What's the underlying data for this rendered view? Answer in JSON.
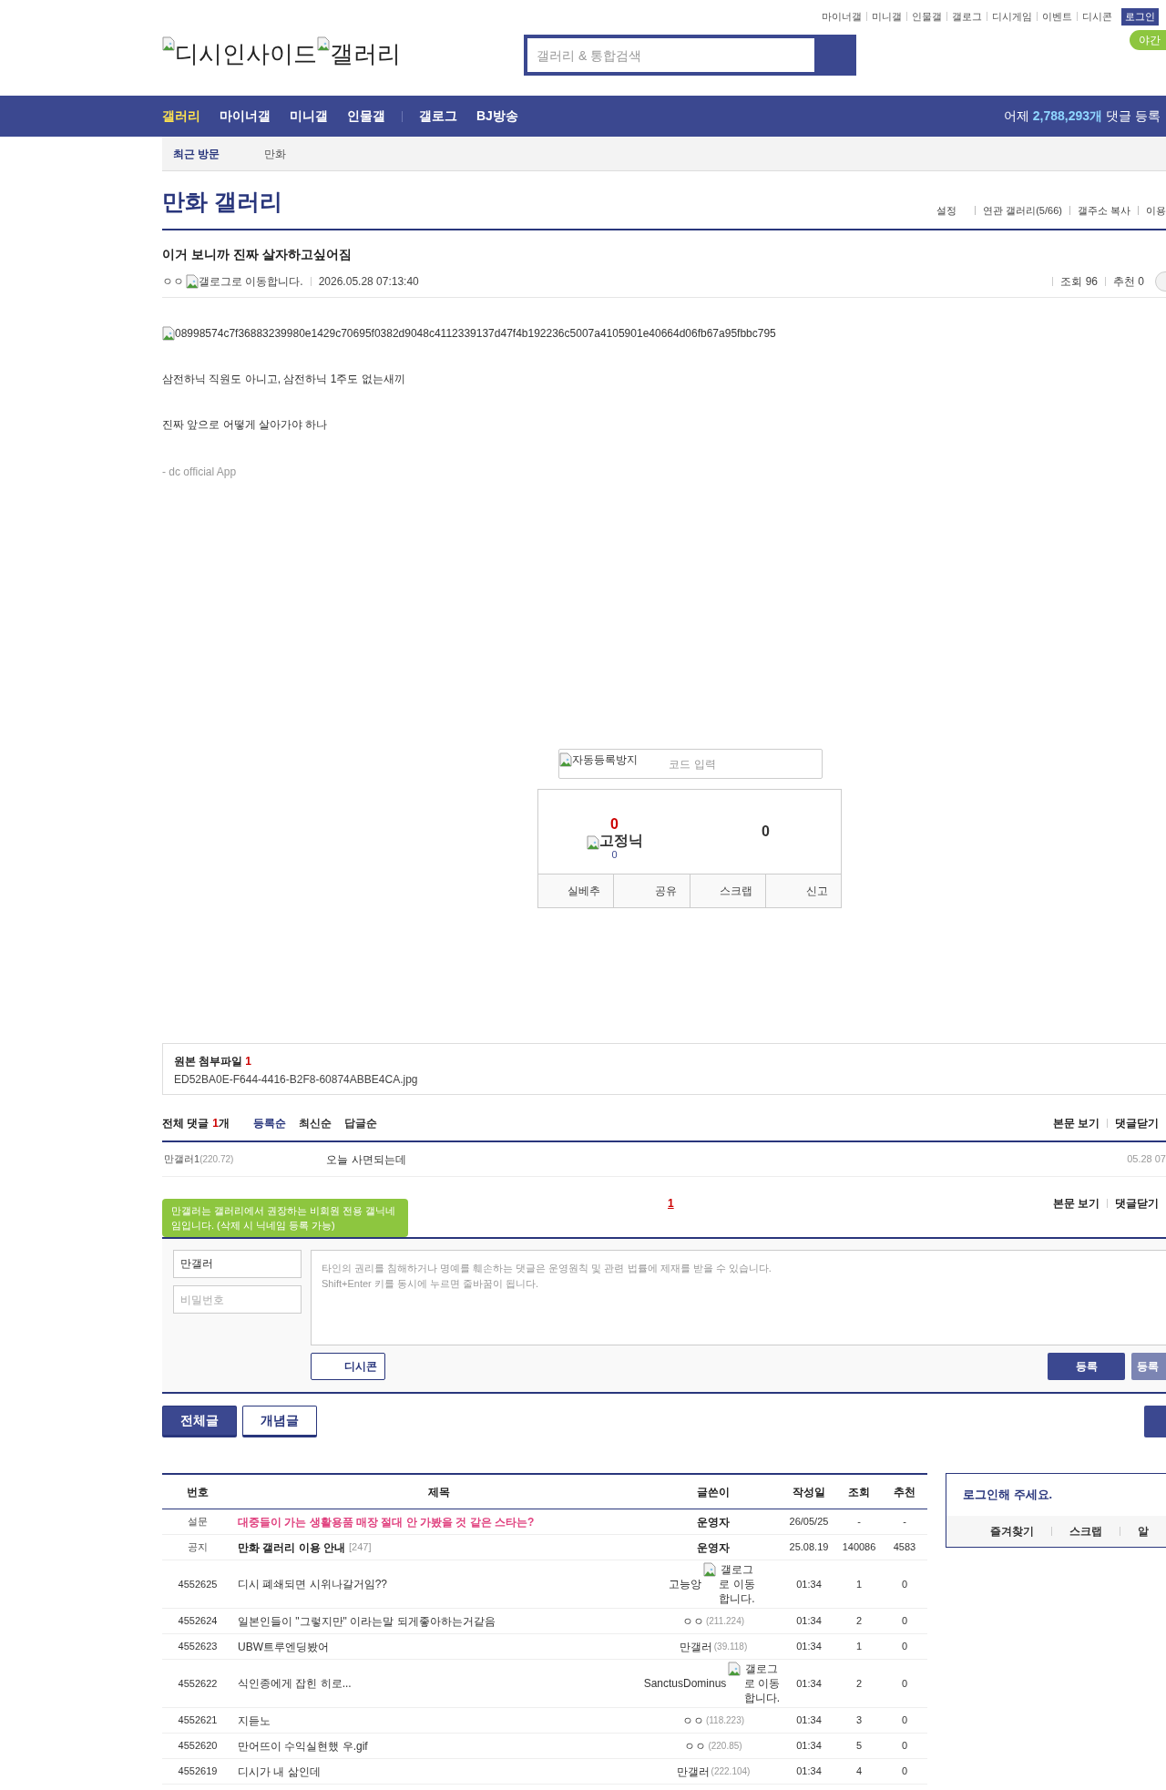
{
  "top_links": [
    "마이너갤",
    "미니갤",
    "인물갤",
    "갤로그",
    "디시게임",
    "이벤트",
    "디시콘"
  ],
  "login_button": "로그인",
  "night_mode": "야간",
  "logo": {
    "site": "디시인사이드",
    "section": "갤러리"
  },
  "search": {
    "placeholder": "갤러리 & 통합검색"
  },
  "nav_groups": [
    [
      {
        "label": "갤러리",
        "selected": true
      },
      {
        "label": "마이너갤",
        "selected": false
      },
      {
        "label": "미니갤",
        "selected": false
      },
      {
        "label": "인물갤",
        "selected": false
      }
    ],
    [
      {
        "label": "갤로그",
        "selected": false
      },
      {
        "label": "BJ방송",
        "selected": false
      }
    ]
  ],
  "stats": {
    "prefix": "어제",
    "count": "2,788,293개",
    "suffix": "댓글 등록"
  },
  "recent": {
    "label": "최근 방문",
    "items": [
      "만화"
    ]
  },
  "gallery": {
    "title": "만화 갤러리",
    "links": [
      "설정",
      "연관 갤러리(5/66)",
      "갤주소 복사",
      "이용"
    ]
  },
  "post": {
    "title": "이거 보니까 진짜 살자하고싶어짐",
    "author": "ㅇㅇ",
    "gallog": "갤로그로 이동합니다.",
    "date": "2026.05.28 07:13:40",
    "views": "조회 96",
    "recommends": "추천 0",
    "image_alt": "08998574c7f36883239980e1429c70695f0382d9048c4112339137d47f4b192236c5007a4105901e40664d06fb67a95fbbc795",
    "paragraphs": [
      "삼전하닉 직원도 아니고, 삼전하닉 1주도 없는새끼",
      "진짜 앞으로 어떻게 살아가야 하나"
    ],
    "signature": "- dc official App"
  },
  "captcha": {
    "image_alt": "자동등록방지",
    "placeholder": "코드 입력"
  },
  "recommend": {
    "up": "0",
    "fixed_label": "고정닉",
    "fixed_count": "0",
    "down": "0",
    "actions": [
      "실베추",
      "공유",
      "스크랩",
      "신고"
    ]
  },
  "attachment": {
    "label": "원본 첨부파일",
    "count": "1",
    "file": "ED52BA0E-F644-4416-B2F8-60874ABBE4CA.jpg"
  },
  "comments": {
    "label": "전체 댓글",
    "count": "1",
    "unit": "개",
    "sorts": [
      {
        "label": "등록순",
        "selected": true
      },
      {
        "label": "최신순",
        "selected": false
      },
      {
        "label": "답글순",
        "selected": false
      }
    ],
    "links": [
      "본문 보기",
      "댓글닫기"
    ],
    "items": [
      {
        "name": "만갤러1",
        "ip": "(220.72)",
        "text": "오늘 사면되는데",
        "date": "05.28 07"
      }
    ],
    "pages": [
      {
        "label": "1",
        "selected": true
      }
    ],
    "bottom_links": [
      "본문 보기",
      "댓글닫기"
    ]
  },
  "comment_form": {
    "tooltip": "만갤러는 갤러리에서 권장하는 비회원 전용 갤닉네임입니다. (삭제 시 닉네임 등록 가능)",
    "nickname": "만갤러",
    "password_placeholder": "비밀번호",
    "placeholder": [
      "타인의 권리를 침해하거나 명예를 훼손하는 댓글은 운영원칙 및 관련 법률에 제재를 받을 수 있습니다.",
      "Shift+Enter 키를 동시에 누르면 줄바꿈이 됩니다."
    ],
    "dccon": "디시콘",
    "submit": "등록",
    "submit_alt": "등록"
  },
  "list_tabs": [
    {
      "label": "전체글",
      "selected": true
    },
    {
      "label": "개념글",
      "selected": false
    }
  ],
  "table": {
    "columns": [
      "번호",
      "제목",
      "글쓴이",
      "작성일",
      "조회",
      "추천"
    ],
    "rows": [
      {
        "kind": "survey",
        "number": "설문",
        "title": "대중들이 가는 생활용품 매장 절대 안 가봤을 것 같은 스타는?",
        "writer": "운영자",
        "date": "26/05/25",
        "views": "-",
        "recommends": "-"
      },
      {
        "kind": "notice",
        "number": "공지",
        "title": "만화 갤러리 이용 안내",
        "replies": "[247]",
        "writer": "운영자",
        "date": "25.08.19",
        "views": "140086",
        "recommends": "4583"
      },
      {
        "kind": "post",
        "number": "4552625",
        "title": "디시 폐쇄되면 시위나갈거임??",
        "writer": "고능앙",
        "gallog": "갤로그로 이동합니다.",
        "date": "01:34",
        "views": "1",
        "recommends": "0"
      },
      {
        "kind": "post",
        "number": "4552624",
        "title": "일본인들이 \"그렇지만\" 이라는말 되게좋아하는거같음",
        "writer": "ㅇㅇ",
        "ip": "(211.224)",
        "date": "01:34",
        "views": "2",
        "recommends": "0"
      },
      {
        "kind": "post",
        "number": "4552623",
        "title": "UBW트루엔딩봤어",
        "writer": "만갤러",
        "ip": "(39.118)",
        "date": "01:34",
        "views": "1",
        "recommends": "0"
      },
      {
        "kind": "post",
        "number": "4552622",
        "title": "식인종에게 잡힌 히로...",
        "writer": "SanctusDominus",
        "gallog": "갤로그로 이동합니다.",
        "date": "01:34",
        "views": "2",
        "recommends": "0"
      },
      {
        "kind": "post",
        "number": "4552621",
        "title": "지듣노",
        "writer": "ㅇㅇ",
        "ip": "(118.223)",
        "date": "01:34",
        "views": "3",
        "recommends": "0"
      },
      {
        "kind": "post",
        "number": "4552620",
        "title": "만어뜨이 수익실현했 우.gif",
        "writer": "ㅇㅇ",
        "ip": "(220.85)",
        "date": "01:34",
        "views": "5",
        "recommends": "0"
      },
      {
        "kind": "post",
        "number": "4552619",
        "title": "디시가 내 삶인데",
        "writer": "만갤러",
        "ip": "(222.104)",
        "date": "01:34",
        "views": "4",
        "recommends": "0"
      }
    ]
  },
  "sidebar": {
    "title": "로그인해 주세요.",
    "links": [
      "즐겨찾기",
      "스크랩",
      "알"
    ]
  }
}
